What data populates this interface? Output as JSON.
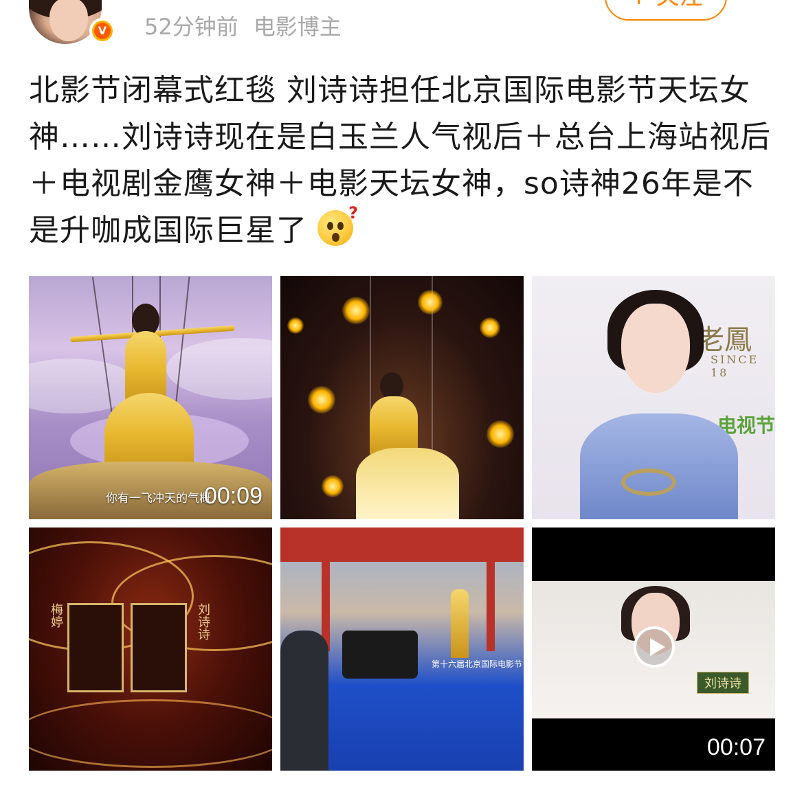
{
  "header": {
    "time_ago": "52分钟前",
    "user_tag": "电影博主",
    "verified_badge": "V",
    "follow_label": "+ 关注"
  },
  "post": {
    "text": "北影节闭幕式红毯 刘诗诗担任北京国际电影节天坛女神……刘诗诗现在是白玉兰人气视后＋总台上海站视后＋电视剧金鹰女神＋电影天坛女神，so诗神26年是不是升咖成国际巨星了",
    "emoji": "question-face-emoji"
  },
  "media": [
    {
      "kind": "video",
      "duration": "00:09",
      "subtitle": "你有一飞冲天的气概"
    },
    {
      "kind": "image"
    },
    {
      "kind": "image",
      "backdrop_text": "老鳳",
      "backdrop_text2": "SINCE 18",
      "green_text": "电视节"
    },
    {
      "kind": "image",
      "panel_left": "梅婷",
      "panel_right": "刘诗诗"
    },
    {
      "kind": "image",
      "festival_text": "第十六届北京国际电影节"
    },
    {
      "kind": "video",
      "duration": "00:07",
      "name_tag": "刘诗诗"
    }
  ],
  "colors": {
    "accent": "#ff8200",
    "meta_gray": "#a8a8a8",
    "text": "#1a1a1a",
    "badge_orange": "#ff5a00"
  }
}
